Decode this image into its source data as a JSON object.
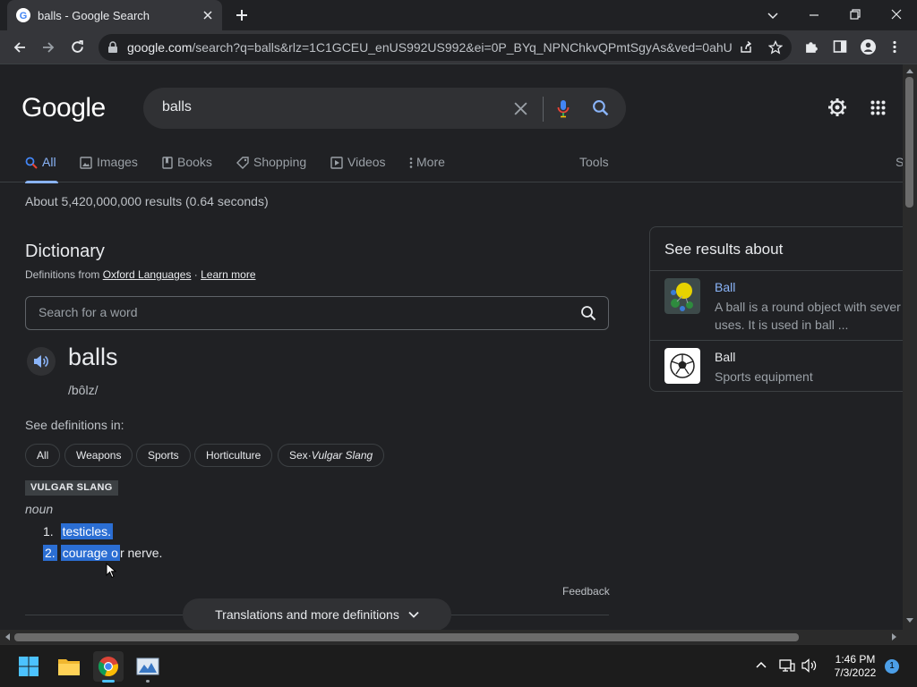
{
  "browser": {
    "tab_title": "balls - Google Search",
    "url_domain": "google.com",
    "url_rest": "/search?q=balls&rlz=1C1GCEU_enUS992US992&ei=0P_BYq_NPNChkvQPmtSgyAs&ved=0ahUK..."
  },
  "search": {
    "logo": "Google",
    "query": "balls"
  },
  "tabs": [
    {
      "label": "All"
    },
    {
      "label": "Images"
    },
    {
      "label": "Books"
    },
    {
      "label": "Shopping"
    },
    {
      "label": "Videos"
    },
    {
      "label": "More"
    }
  ],
  "tools_label": "Tools",
  "clipped_label": "S",
  "stats": "About 5,420,000,000 results (0.64 seconds)",
  "dictionary": {
    "title": "Dictionary",
    "source_prefix": "Definitions from ",
    "source_link": "Oxford Languages",
    "separator": " · ",
    "learn_more": "Learn more",
    "word_search_placeholder": "Search for a word",
    "headword": "balls",
    "phonetic": "/bôlz/",
    "see_definitions": "See definitions in:",
    "chips": [
      "All",
      "Weapons",
      "Sports",
      "Horticulture"
    ],
    "chip_sex": "Sex",
    "chip_sex_sep": " · ",
    "chip_sex_tag": "Vulgar Slang",
    "usage_label": "VULGAR SLANG",
    "part_of_speech": "noun",
    "definitions": [
      {
        "num": "1.",
        "text": "testicles."
      },
      {
        "num": "2.",
        "text_selected": "courage o",
        "text_rest": "r nerve."
      }
    ],
    "feedback": "Feedback",
    "more_button": "Translations and more definitions"
  },
  "knowledge_panel": {
    "title": "See results about",
    "items": [
      {
        "name": "Ball",
        "desc_line1": "A ball is a round object with sever",
        "desc_line2": "uses. It is used in ball ...",
        "name_color": "#8ab4f8"
      },
      {
        "name": "Ball",
        "desc_line1": "Sports equipment",
        "name_color": "#e8eaed"
      }
    ]
  },
  "taskbar": {
    "time": "1:46 PM",
    "date": "7/3/2022",
    "notifications": "1"
  },
  "colors": {
    "accent": "#8ab4f8",
    "selection": "#2b6ed3"
  }
}
